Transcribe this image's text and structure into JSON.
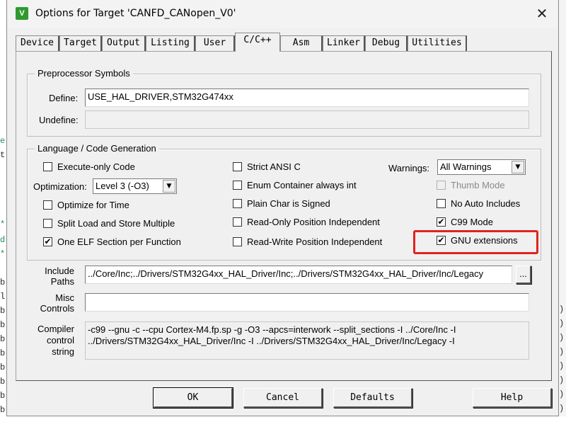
{
  "dialog": {
    "title": "Options for Target 'CANFD_CANopen_V0'",
    "app_icon_letter": "V",
    "close_glyph": "✕"
  },
  "tabs": [
    {
      "label": "Device"
    },
    {
      "label": "Target"
    },
    {
      "label": "Output"
    },
    {
      "label": "Listing"
    },
    {
      "label": "User"
    },
    {
      "label": "C/C++"
    },
    {
      "label": "Asm"
    },
    {
      "label": "Linker"
    },
    {
      "label": "Debug"
    },
    {
      "label": "Utilities"
    }
  ],
  "active_tab": "C/C++",
  "preprocessor": {
    "legend": "Preprocessor Symbols",
    "define_label": "Define:",
    "define_value": "USE_HAL_DRIVER,STM32G474xx",
    "undefine_label": "Undefine:",
    "undefine_value": ""
  },
  "codegen": {
    "legend": "Language / Code Generation",
    "execute_only": {
      "label": "Execute-only Code",
      "checked": false
    },
    "optimization_label": "Optimization:",
    "optimization_value": "Level 3 (-O3)",
    "optimize_time": {
      "label": "Optimize for Time",
      "checked": false
    },
    "split_load": {
      "label": "Split Load and Store Multiple",
      "checked": false
    },
    "one_elf": {
      "label": "One ELF Section per Function",
      "checked": true
    },
    "strict_ansi": {
      "label": "Strict ANSI C",
      "checked": false
    },
    "enum_container": {
      "label": "Enum Container always int",
      "checked": false
    },
    "plain_char": {
      "label": "Plain Char is Signed",
      "checked": false
    },
    "ro_position": {
      "label": "Read-Only Position Independent",
      "checked": false
    },
    "rw_position": {
      "label": "Read-Write Position Independent",
      "checked": false
    },
    "warnings_label": "Warnings:",
    "warnings_value": "All Warnings",
    "thumb_mode": {
      "label": "Thumb Mode",
      "checked": false,
      "disabled": true
    },
    "no_auto_includes": {
      "label": "No Auto Includes",
      "checked": false
    },
    "c99_mode": {
      "label": "C99 Mode",
      "checked": true
    },
    "gnu_extensions": {
      "label": "GNU extensions",
      "checked": true
    }
  },
  "include": {
    "label_line1": "Include",
    "label_line2": "Paths",
    "value": "../Core/Inc;../Drivers/STM32G4xx_HAL_Driver/Inc;../Drivers/STM32G4xx_HAL_Driver/Inc/Legacy",
    "browse_label": "..."
  },
  "misc": {
    "label_line1": "Misc",
    "label_line2": "Controls",
    "value": ""
  },
  "compiler": {
    "label_line1": "Compiler",
    "label_line2": "control",
    "label_line3": "string",
    "line1": "-c99 --gnu -c --cpu Cortex-M4.fp.sp -g -O3 --apcs=interwork --split_sections -I ../Core/Inc -I",
    "line2": "../Drivers/STM32G4xx_HAL_Driver/Inc -I ../Drivers/STM32G4xx_HAL_Driver/Inc/Legacy -I"
  },
  "buttons": {
    "ok": "OK",
    "cancel": "Cancel",
    "defaults": "Defaults",
    "help": "Help"
  },
  "checkmark_glyph": "✔",
  "dropdown_arrow_glyph": "▼",
  "colors": {
    "highlight": "#e0231e",
    "dialog_bg": "#f0f0f0",
    "app_icon": "#2e9a2e"
  }
}
